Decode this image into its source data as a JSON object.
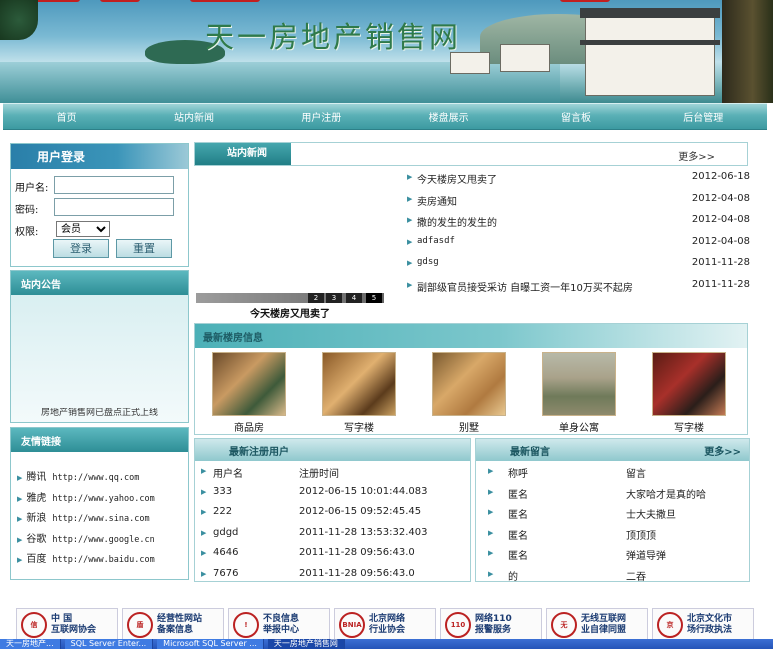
{
  "site_title": "天一房地产销售网",
  "nav": [
    "首页",
    "站内新闻",
    "用户注册",
    "楼盘展示",
    "留言板",
    "后台管理"
  ],
  "login": {
    "title": "用户登录",
    "username_label": "用户名:",
    "password_label": "密码:",
    "role_label": "权限:",
    "role_selected": "会员",
    "login_button": "登录",
    "reset_button": "重置"
  },
  "notice": {
    "title": "站内公告",
    "marquee": "房地产销售网已盘点正式上线"
  },
  "links": {
    "title": "友情链接",
    "items": [
      {
        "name": "腾讯",
        "url": "http://www.qq.com"
      },
      {
        "name": "雅虎",
        "url": "http://www.yahoo.com"
      },
      {
        "name": "新浪",
        "url": "http://www.sina.com"
      },
      {
        "name": "谷歌",
        "url": "http://www.google.cn"
      },
      {
        "name": "百度",
        "url": "http://www.baidu.com"
      }
    ]
  },
  "news": {
    "title": "站内新闻",
    "more": "更多>>",
    "items": [
      {
        "title": "今天楼房又甩卖了",
        "date": "2012-06-18"
      },
      {
        "title": "卖房通知",
        "date": "2012-04-08"
      },
      {
        "title": "撒的发生的发生的",
        "date": "2012-04-08"
      },
      {
        "title": "adfasdf",
        "date": "2012-04-08"
      },
      {
        "title": "gdsg",
        "date": "2011-11-28"
      },
      {
        "title": "副部级官员接受采访 自曝工资一年10万买不起房",
        "date": "2011-11-28"
      }
    ],
    "slider_numbers": [
      "2",
      "3",
      "4",
      "5"
    ],
    "slider_caption": "今天楼房又甩卖了"
  },
  "properties": {
    "title": "最新楼房信息",
    "items": [
      "商品房",
      "写字楼",
      "别墅",
      "单身公寓",
      "写字楼"
    ]
  },
  "users": {
    "title": "最新注册用户",
    "headers": [
      "用户名",
      "注册时间"
    ],
    "rows": [
      [
        "333",
        "2012-06-15 10:01:44.083"
      ],
      [
        "222",
        "2012-06-15 09:52:45.45"
      ],
      [
        "gdgd",
        "2011-11-28 13:53:32.403"
      ],
      [
        "4646",
        "2011-11-28 09:56:43.0"
      ],
      [
        "7676",
        "2011-11-28 09:56:43.0"
      ]
    ]
  },
  "messages": {
    "title": "最新留言",
    "more": "更多>>",
    "headers": [
      "称呼",
      "留言"
    ],
    "rows": [
      [
        "匿名",
        "大家哈才是真的哈"
      ],
      [
        "匿名",
        "士大夫撒旦"
      ],
      [
        "匿名",
        "顶顶顶"
      ],
      [
        "匿名",
        "弹道导弹"
      ],
      [
        "的",
        "二吞"
      ]
    ]
  },
  "partners": [
    {
      "seal": "信",
      "text": "中 国|互联网协会"
    },
    {
      "seal": "盾",
      "text": "经营性网站|备案信息"
    },
    {
      "seal": "!",
      "text": "不良信息|举报中心"
    },
    {
      "seal": "BNIA",
      "text": "北京网络|行业协会"
    },
    {
      "seal": "110",
      "text": "网络110|报警服务"
    },
    {
      "seal": "无",
      "text": "无线互联网|业自律同盟"
    },
    {
      "seal": "京",
      "text": "北京文化市|场行政执法"
    }
  ],
  "taskbar": [
    "天一房地产...",
    "SQL Server Enter...",
    "Microsoft SQL Server ...",
    "天一房地产销售网"
  ],
  "colors": {
    "accent": "#2e8e96",
    "nav": "#3c9aa1",
    "banner_title": "#2f7a4a"
  }
}
